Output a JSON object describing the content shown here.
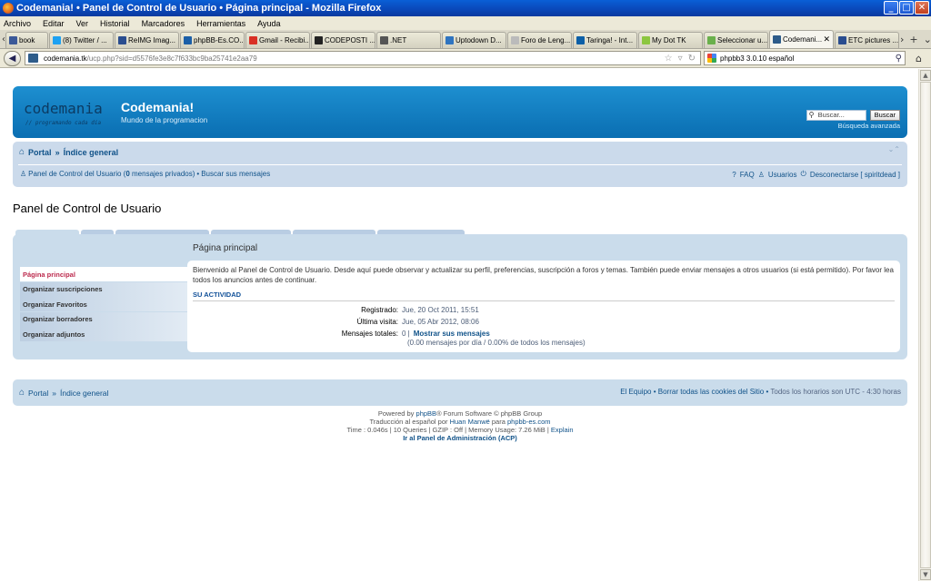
{
  "window": {
    "title": "Codemania! • Panel de Control de Usuario • Página principal - Mozilla Firefox",
    "buttons": {
      "minimize": "_",
      "maximize": "□",
      "close": "✕"
    }
  },
  "menubar": [
    "Archivo",
    "Editar",
    "Ver",
    "Historial",
    "Marcadores",
    "Herramientas",
    "Ayuda"
  ],
  "tabs": [
    {
      "label": "book",
      "icon_color": "#3b5998"
    },
    {
      "label": "(8) Twitter / ...",
      "icon_color": "#1da1f2"
    },
    {
      "label": "ReIMG Imag...",
      "icon_color": "#2a4d8f"
    },
    {
      "label": "phpBB-Es.CO...",
      "icon_color": "#1b5fa8"
    },
    {
      "label": "Gmail - Recibi...",
      "icon_color": "#d93025"
    },
    {
      "label": "CODEPOSTI ...",
      "icon_color": "#222222"
    },
    {
      "label": ".NET",
      "icon_color": "#555555"
    },
    {
      "label": "Uptodown D...",
      "icon_color": "#2f74c0"
    },
    {
      "label": "Foro de Leng...",
      "icon_color": "#bbbbbb"
    },
    {
      "label": "Taringa! - Int...",
      "icon_color": "#0c5fa7"
    },
    {
      "label": "My Dot TK",
      "icon_color": "#8cc63f"
    },
    {
      "label": "Seleccionar u...",
      "icon_color": "#6ab04c"
    },
    {
      "label": "Codemani...",
      "icon_color": "#2e5c8a",
      "active": true
    },
    {
      "label": "ETC pictures ...",
      "icon_color": "#2a4d8f"
    }
  ],
  "tabbar_controls": {
    "scroll_right": "›",
    "new_tab": "+",
    "list": "⌄"
  },
  "navbar": {
    "back": "◀",
    "url_host": "codemania.tk",
    "url_path": "/ucp.php?sid=d5576fe3e8c7f633bc9ba25741e2aa79",
    "search_value": "phpbb3 3.0.10 español"
  },
  "header": {
    "logo": "codemania",
    "logo_sub": "// programando cada dia",
    "site_title": "Codemania!",
    "site_desc": "Mundo de la programacion",
    "search_placeholder": "Buscar...",
    "search_button": "Buscar",
    "advanced_search": "Búsqueda avanzada"
  },
  "breadcrumbs": {
    "portal": "Portal",
    "sep": "»",
    "index": "Índice general"
  },
  "navlinks": {
    "ucp_prefix": "Panel de Control del Usuario (",
    "ucp_count": "0",
    "ucp_suffix": " mensajes privados)",
    "bullet": "•",
    "search_posts": "Buscar sus mensajes",
    "faq": "FAQ",
    "users": "Usuarios",
    "logout": "Desconectarse [ spiritdead ]"
  },
  "ucp": {
    "page_title": "Panel de Control de Usuario",
    "content_title": "Página principal",
    "menu": [
      {
        "label": "Página principal",
        "active": true
      },
      {
        "label": "Organizar suscripciones"
      },
      {
        "label": "Organizar Favoritos"
      },
      {
        "label": "Organizar borradores"
      },
      {
        "label": "Organizar adjuntos"
      }
    ],
    "welcome": "Bienvenido al Panel de Control de Usuario. Desde aquí puede observar y actualizar su perfil, preferencias, suscripción a foros y temas. También puede enviar mensajes a otros usuarios (si está permitido). Por favor lea todos los anuncios antes de continuar.",
    "activity_heading": "SU ACTIVIDAD",
    "stats": {
      "registered_label": "Registrado:",
      "registered_value": "Jue, 20 Oct 2011, 15:51",
      "last_visit_label": "Última visita:",
      "last_visit_value": "Jue, 05 Abr 2012, 08:06",
      "total_posts_label": "Mensajes totales:",
      "total_posts_value": "0 |",
      "show_posts_link": "Mostrar sus mensajes",
      "posts_detail": "(0.00 mensajes por día / 0.00% de todos los mensajes)"
    }
  },
  "footer": {
    "portal": "Portal",
    "sep": "»",
    "index": "Índice general",
    "team": "El Equipo",
    "bullet": "•",
    "delete_cookies": "Borrar todas las cookies del Sitio",
    "timezone": "Todos los horarios son UTC - 4:30 horas",
    "powered_prefix": "Powered by ",
    "powered_link": "phpBB",
    "powered_suffix": "® Forum Software © phpBB Group",
    "translation_prefix": "Traducción al español por ",
    "translation_author": "Huan Manwë",
    "translation_mid": " para ",
    "translation_site": "phpbb-es.com",
    "debug_prefix": "Time : 0.046s | 10 Queries | GZIP : Off | Memory Usage: 7.26 MiB | ",
    "explain": "Explain",
    "acp": "Ir al Panel de Administración (ACP)"
  }
}
